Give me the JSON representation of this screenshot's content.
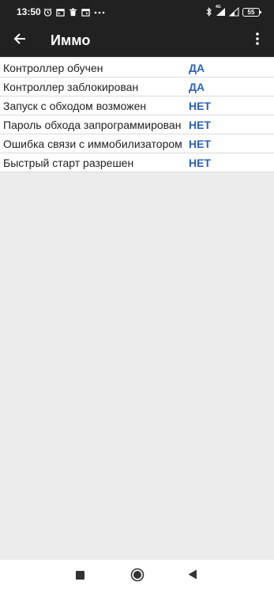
{
  "status_bar": {
    "time": "13:50",
    "signal_type": "4G",
    "battery_level": "55",
    "left_icons": [
      "alarm-icon",
      "calendar-icon",
      "trash-icon",
      "calendar-icon",
      "more-dots-icon"
    ],
    "right_icons": [
      "bluetooth-icon",
      "signal-icon",
      "signal-icon",
      "battery-icon"
    ]
  },
  "app_bar": {
    "title": "Иммо",
    "back_icon": "arrow-left-icon",
    "menu_icon": "more-vertical-icon"
  },
  "list": {
    "rows": [
      {
        "label": "Контроллер обучен",
        "value": "ДА"
      },
      {
        "label": "Контроллер заблокирован",
        "value": "ДА"
      },
      {
        "label": "Запуск с обходом возможен",
        "value": "НЕТ"
      },
      {
        "label": "Пароль обхода запрограммирован",
        "value": "НЕТ"
      },
      {
        "label": "Ошибка связи с иммобилизатором",
        "value": "НЕТ"
      },
      {
        "label": "Быстрый старт разрешен",
        "value": "НЕТ"
      }
    ]
  },
  "nav_bar": {
    "icons": [
      "recents-square-icon",
      "home-circle-icon",
      "back-triangle-icon"
    ]
  },
  "colors": {
    "app_bar_bg": "#212121",
    "value_blue": "#2b62b5",
    "content_bg": "#ececec",
    "row_divider": "#d9d9d9"
  }
}
